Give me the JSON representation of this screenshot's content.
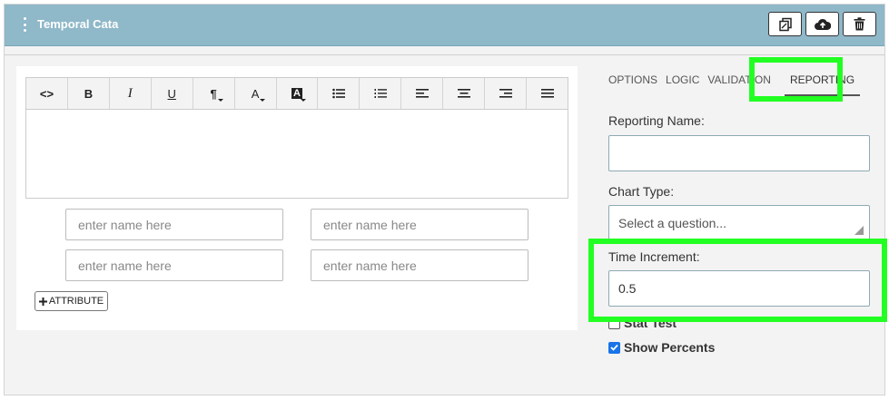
{
  "header": {
    "title": "Temporal Cata",
    "buttons": [
      {
        "name": "copy-button",
        "icon": "copy-icon"
      },
      {
        "name": "upload-button",
        "icon": "cloud-upload-icon"
      },
      {
        "name": "delete-button",
        "icon": "trash-icon"
      }
    ]
  },
  "toolbar": {
    "items": [
      {
        "label": "<>",
        "name": "code-view-button"
      },
      {
        "label": "B",
        "name": "bold-button"
      },
      {
        "label": "I",
        "name": "italic-button"
      },
      {
        "label": "U",
        "name": "underline-button"
      },
      {
        "label": "¶",
        "name": "paragraph-button"
      },
      {
        "label": "A",
        "name": "font-color-button"
      },
      {
        "label": "A",
        "name": "highlight-color-button"
      },
      {
        "label": "",
        "name": "unordered-list-button"
      },
      {
        "label": "",
        "name": "ordered-list-button"
      },
      {
        "label": "",
        "name": "align-left-button"
      },
      {
        "label": "",
        "name": "align-center-button"
      },
      {
        "label": "",
        "name": "align-right-button"
      },
      {
        "label": "",
        "name": "justify-button"
      }
    ]
  },
  "attributes": {
    "placeholder": "enter name here",
    "add_label": "ATTRIBUTE"
  },
  "tabs": [
    "OPTIONS",
    "LOGIC",
    "VALIDATION",
    "REPORTING"
  ],
  "active_tab": "REPORTING",
  "reporting": {
    "reporting_name_label": "Reporting Name:",
    "reporting_name_value": "",
    "chart_type_label": "Chart Type:",
    "chart_type_value": "Select a question...",
    "time_increment_label": "Time Increment:",
    "time_increment_value": "0.5",
    "stat_test_label": "Stat Test",
    "stat_test_checked": false,
    "show_percents_label": "Show Percents",
    "show_percents_checked": true
  },
  "colors": {
    "header_bg": "#8fb8c9",
    "highlight": "#22ff22",
    "checkbox_on": "#1a73e8"
  }
}
